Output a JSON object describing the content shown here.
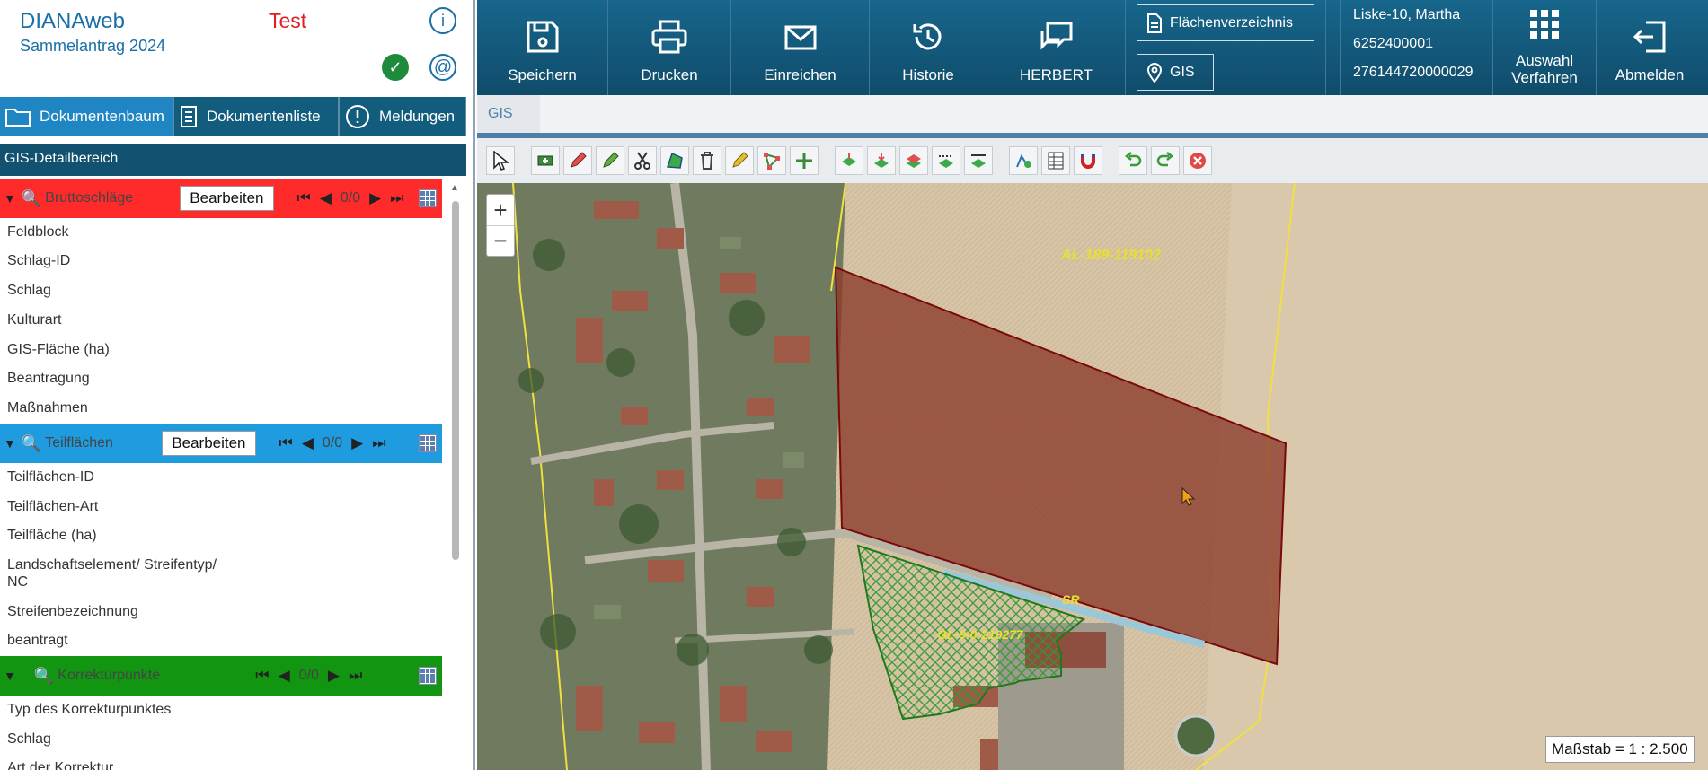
{
  "header": {
    "app_name": "DIANAweb",
    "subtitle": "Sammelantrag 2024",
    "env_label": "Test",
    "info_icon": "info-icon",
    "check_icon": "check-icon",
    "at_icon": "at-icon"
  },
  "left_tabs": [
    {
      "label": "Dokumentenbaum",
      "icon": "folder-icon"
    },
    {
      "label": "Dokumentenliste",
      "icon": "document-list-icon"
    },
    {
      "label": "Meldungen",
      "icon": "alert-icon"
    }
  ],
  "detail_header": "GIS-Detailbereich",
  "layers": [
    {
      "name": "Bruttoschläge",
      "color": "#ff2a2a",
      "edit_label": "Bearbeiten",
      "counter": "0/0",
      "fields": [
        "Feldblock",
        "Schlag-ID",
        "Schlag",
        "Kulturart",
        "GIS-Fläche (ha)",
        "Beantragung",
        "Maßnahmen"
      ]
    },
    {
      "name": "Teilflächen",
      "color": "#1f9be0",
      "edit_label": "Bearbeiten",
      "counter": "0/0",
      "fields": [
        "Teilflächen-ID",
        "Teilflächen-Art",
        "Teilfläche (ha)",
        "Landschaftselement/ Streifentyp/",
        "NC",
        "Streifenbezeichnung",
        "beantragt"
      ]
    },
    {
      "name": "Korrekturpunkte",
      "color": "#129612",
      "counter": "0/0",
      "fields": [
        "Typ des Korrekturpunktes",
        "Schlag",
        "Art der Korrektur"
      ]
    }
  ],
  "topbar": {
    "buttons": [
      {
        "label": "Speichern",
        "icon": "save-icon"
      },
      {
        "label": "Drucken",
        "icon": "print-icon"
      },
      {
        "label": "Einreichen",
        "icon": "submit-mail-icon"
      },
      {
        "label": "Historie",
        "icon": "history-icon"
      },
      {
        "label": "HERBERT",
        "icon": "chat-icon"
      }
    ],
    "flaechen_label": "Flächenverzeichnis",
    "gis_label": "GIS",
    "user_name": "Liske-10, Martha",
    "user_id1": "6252400001",
    "user_id2": "276144720000029",
    "auswahl_line1": "Auswahl",
    "auswahl_line2": "Verfahren",
    "logout_label": "Abmelden"
  },
  "gis_tab_label": "GIS",
  "map": {
    "zoom_in": "+",
    "zoom_out": "−",
    "scale_label": "Maßstab = 1 : 2.500",
    "label_al": "AL-189-119102",
    "label_gl": "GL-9-0-219277",
    "label_sr": "SR"
  }
}
